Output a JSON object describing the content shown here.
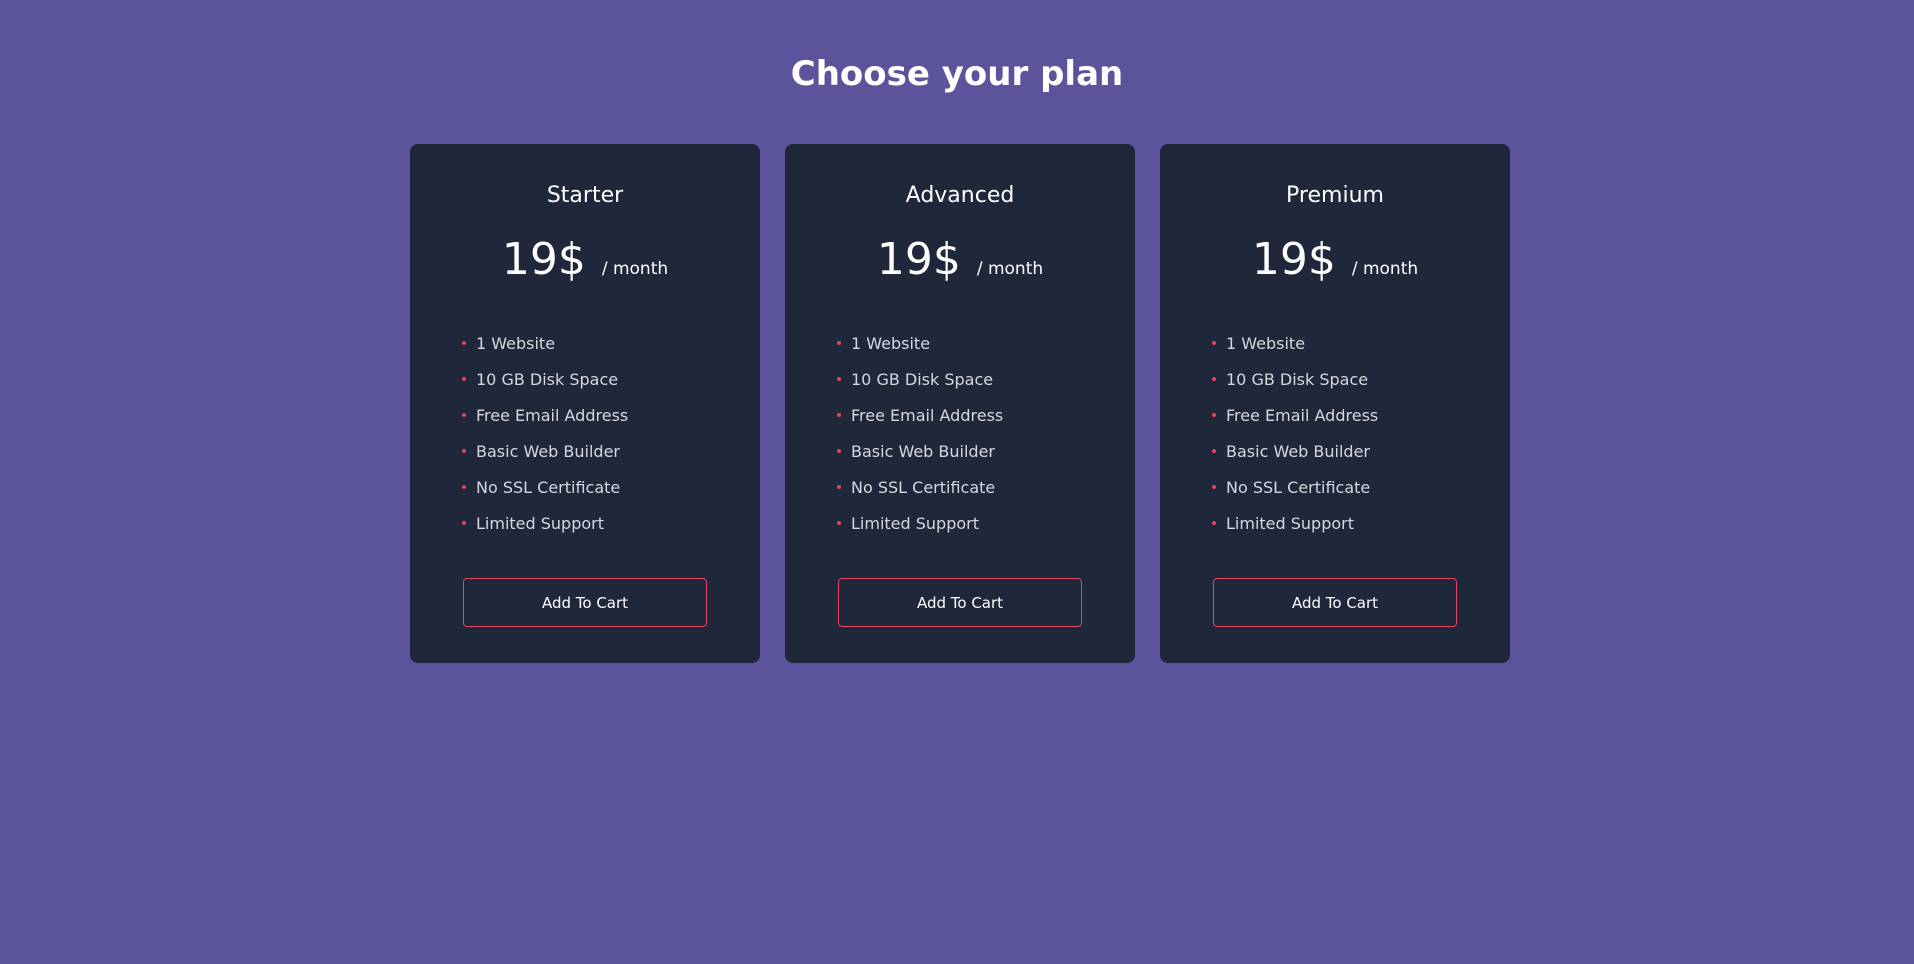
{
  "page": {
    "title": "Choose your plan"
  },
  "colors": {
    "background": "#5b539c",
    "card": "#1f273b",
    "accent": "#e8435f",
    "text": "#ffffff",
    "feature_text": "#d6d8e0"
  },
  "plans": [
    {
      "name": "Starter",
      "price": "19$",
      "period": "/ month",
      "features": [
        "1 Website",
        "10 GB Disk Space",
        "Free Email Address",
        "Basic Web Builder",
        "No SSL Certificate",
        "Limited Support"
      ],
      "button_label": "Add To Cart"
    },
    {
      "name": "Advanced",
      "price": "19$",
      "period": "/ month",
      "features": [
        "1 Website",
        "10 GB Disk Space",
        "Free Email Address",
        "Basic Web Builder",
        "No SSL Certificate",
        "Limited Support"
      ],
      "button_label": "Add To Cart"
    },
    {
      "name": "Premium",
      "price": "19$",
      "period": "/ month",
      "features": [
        "1 Website",
        "10 GB Disk Space",
        "Free Email Address",
        "Basic Web Builder",
        "No SSL Certificate",
        "Limited Support"
      ],
      "button_label": "Add To Cart"
    }
  ]
}
